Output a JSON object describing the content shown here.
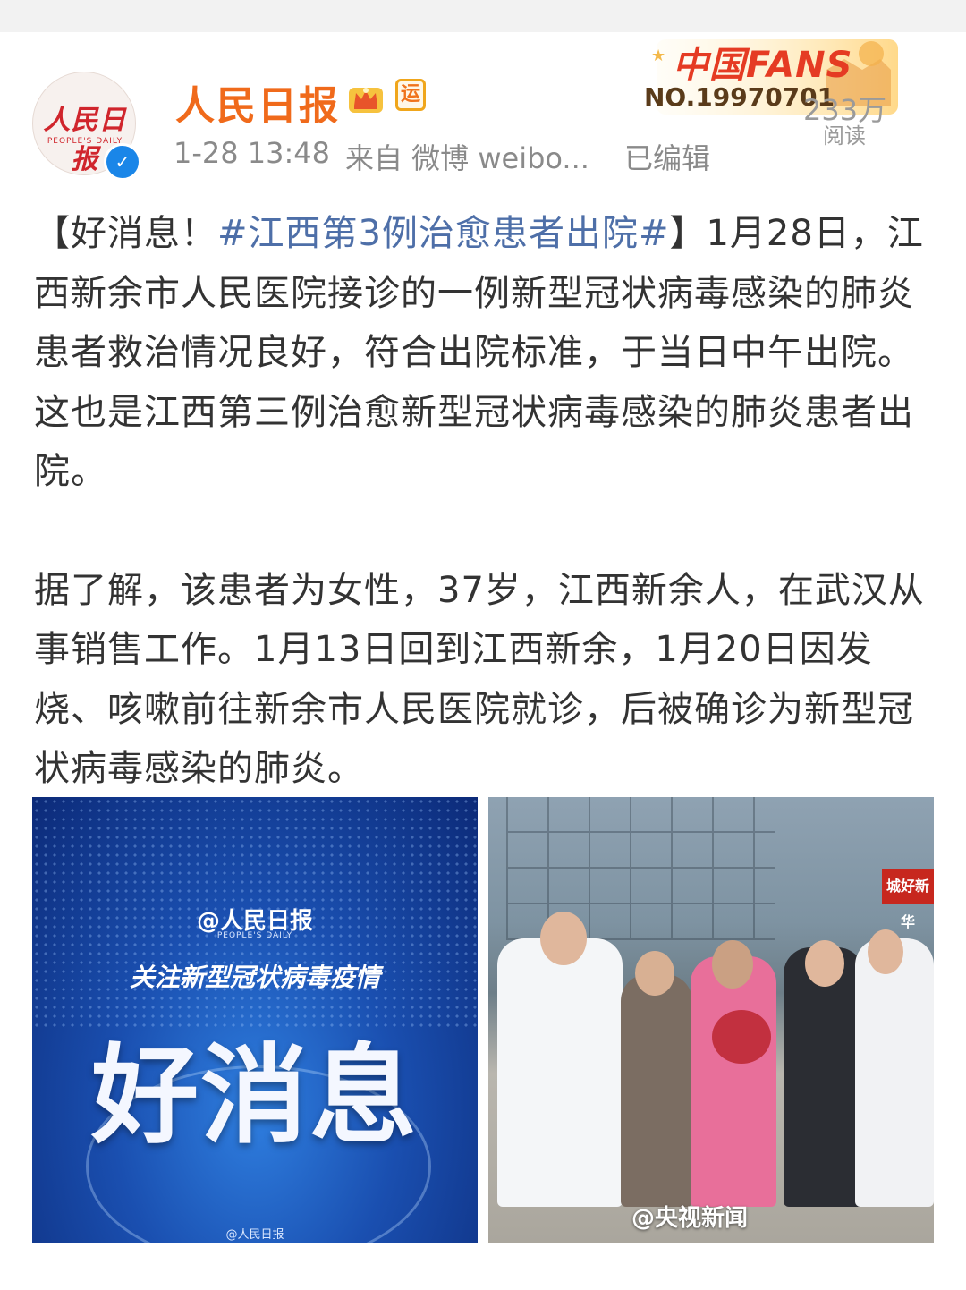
{
  "header": {
    "avatar_logo": "人民日报",
    "avatar_sub": "PEOPLE'S DAILY",
    "username": "人民日报",
    "verified_icon": "verified-check-icon",
    "crown_icon": "crown-vip-icon",
    "badge_text": "运",
    "time": "1-28 13:48",
    "source": "来自 微博 weibo...",
    "edited": "已编辑",
    "fans_banner_title": "中国FANS",
    "fans_no": "NO.19970701",
    "reads_count": "233万",
    "reads_label": "阅读"
  },
  "post": {
    "p1_prefix": "【好消息！",
    "p1_hashtag": "#江西第3例治愈患者出院#",
    "p1_rest": "】1月28日，江西新余市人民医院接诊的一例新型冠状病毒感染的肺炎患者救治情况良好，符合出院标准，于当日中午出院。这也是江西第三例治愈新型冠状病毒感染的肺炎患者出院。",
    "p2": "据了解，该患者为女性，37岁，江西新余人，在武汉从事销售工作。1月13日回到江西新余，1月20日因发烧、咳嗽前往新余市人民医院就诊，后被确诊为新型冠状病毒感染的肺炎。"
  },
  "images": {
    "left": {
      "logo": "@人民日报",
      "logo_sub": "PEOPLE'S DAILY",
      "subtitle": "关注新型冠状病毒疫情",
      "big_text": "好消息",
      "watermark": "@人民日报"
    },
    "right": {
      "sign_text": "城好新华",
      "watermark": "@央视新闻"
    }
  },
  "colors": {
    "username": "#f06a1b",
    "hashtag": "#4e6fa8",
    "meta": "#8a8a8a",
    "verified": "#1a86e8"
  }
}
